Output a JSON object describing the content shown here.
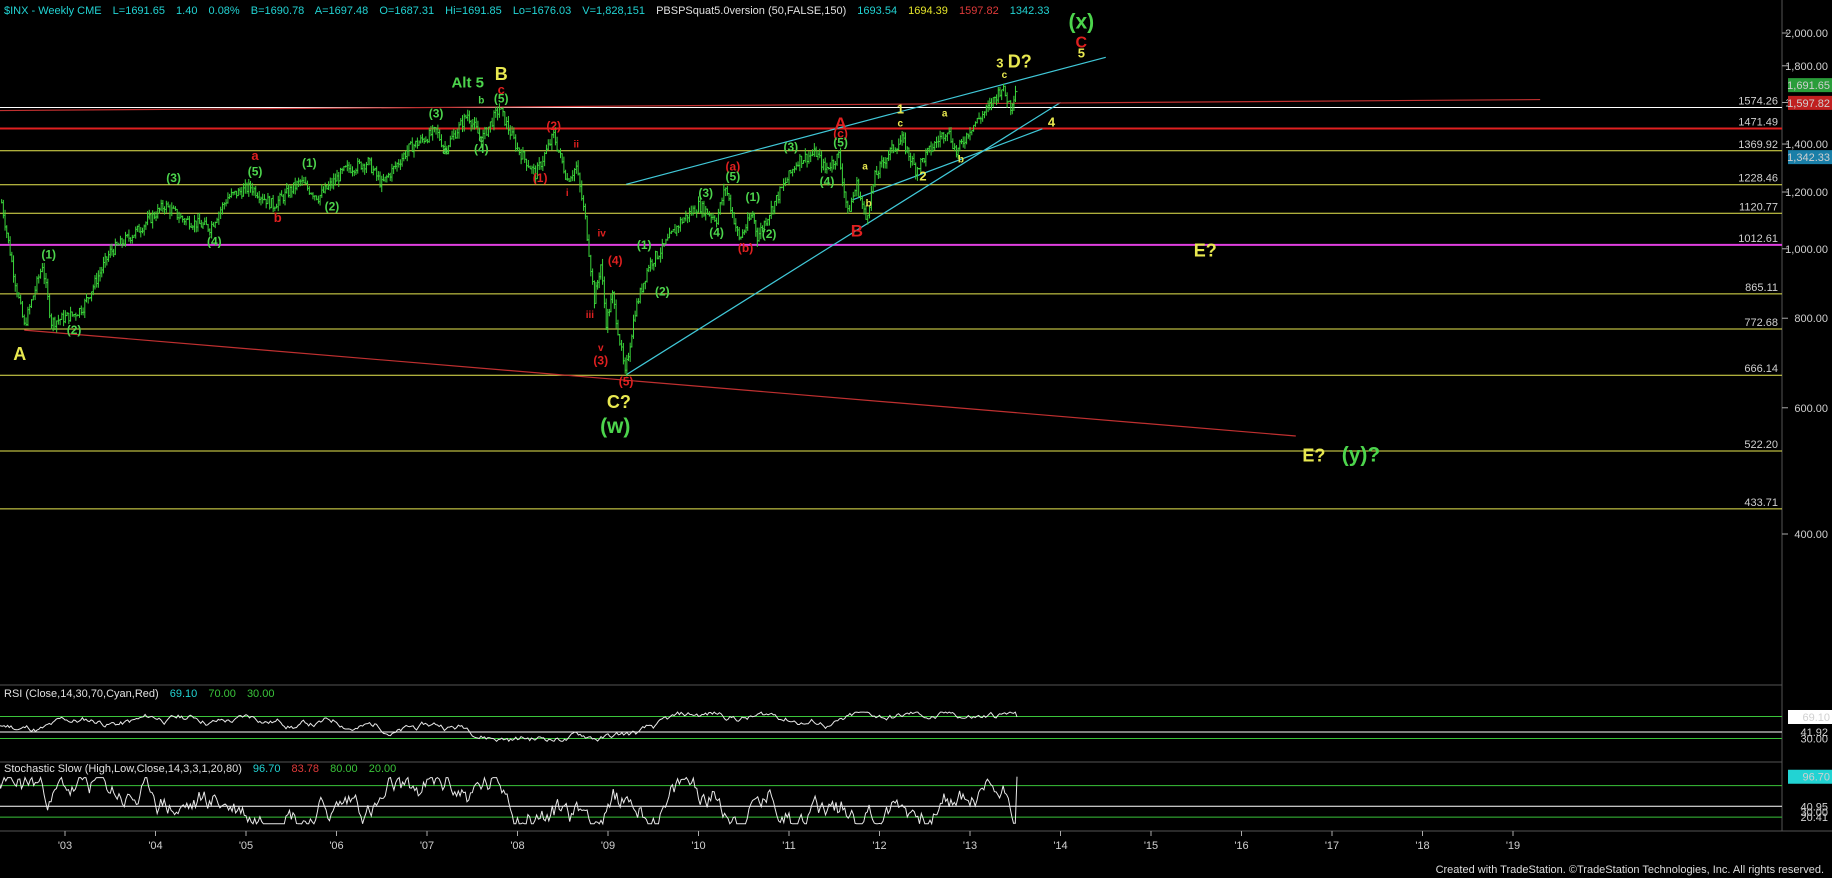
{
  "header": {
    "title": "$INX - Weekly  CME",
    "last": "L=1691.65",
    "change": "1.40",
    "pct": "0.08%",
    "bid": "B=1690.78",
    "ask": "A=1697.48",
    "open": "O=1687.31",
    "high": "Hi=1691.85",
    "low": "Lo=1676.03",
    "volume": "V=1,828,151",
    "indicator": "PBSPSquat5.0version (50,FALSE,150)",
    "ind_values": [
      "1693.54",
      "1694.39",
      "1597.82",
      "1342.33"
    ]
  },
  "chart_data": {
    "type": "ohlc",
    "title": "$INX - Weekly",
    "y_scale": "log",
    "ylim": [
      330,
      2200
    ],
    "y_ticks": [
      "2,000.00",
      "1,800.00",
      "1,600.00",
      "1,400.00",
      "1,200.00",
      "1,000.00",
      "800.00",
      "600.00",
      "400.00"
    ],
    "x_ticks": [
      "'03",
      "'04",
      "'05",
      "'06",
      "'07",
      "'08",
      "'09",
      "'10",
      "'11",
      "'12",
      "'13",
      "'14",
      "'15",
      "'16",
      "'17",
      "'18",
      "'19"
    ],
    "price_path": [
      [
        2002.3,
        1160
      ],
      [
        2002.45,
        900
      ],
      [
        2002.55,
        780
      ],
      [
        2002.75,
        950
      ],
      [
        2002.85,
        790
      ],
      [
        2003.1,
        810
      ],
      [
        2003.2,
        830
      ],
      [
        2003.5,
        990
      ],
      [
        2003.8,
        1060
      ],
      [
        2004.1,
        1150
      ],
      [
        2004.3,
        1100
      ],
      [
        2004.6,
        1070
      ],
      [
        2004.8,
        1180
      ],
      [
        2005.05,
        1220
      ],
      [
        2005.3,
        1150
      ],
      [
        2005.6,
        1240
      ],
      [
        2005.8,
        1180
      ],
      [
        2006.1,
        1290
      ],
      [
        2006.35,
        1320
      ],
      [
        2006.5,
        1230
      ],
      [
        2006.8,
        1380
      ],
      [
        2007.1,
        1460
      ],
      [
        2007.2,
        1380
      ],
      [
        2007.45,
        1540
      ],
      [
        2007.6,
        1420
      ],
      [
        2007.8,
        1570
      ],
      [
        2008.0,
        1380
      ],
      [
        2008.2,
        1270
      ],
      [
        2008.4,
        1440
      ],
      [
        2008.55,
        1250
      ],
      [
        2008.65,
        1300
      ],
      [
        2008.75,
        1100
      ],
      [
        2008.85,
        850
      ],
      [
        2008.92,
        950
      ],
      [
        2008.98,
        790
      ],
      [
        2009.05,
        860
      ],
      [
        2009.19,
        667
      ],
      [
        2009.3,
        820
      ],
      [
        2009.45,
        950
      ],
      [
        2009.6,
        1000
      ],
      [
        2009.8,
        1090
      ],
      [
        2010.0,
        1150
      ],
      [
        2010.2,
        1100
      ],
      [
        2010.3,
        1220
      ],
      [
        2010.45,
        1030
      ],
      [
        2010.6,
        1120
      ],
      [
        2010.65,
        1040
      ],
      [
        2010.9,
        1200
      ],
      [
        2011.1,
        1330
      ],
      [
        2011.3,
        1360
      ],
      [
        2011.4,
        1290
      ],
      [
        2011.55,
        1350
      ],
      [
        2011.65,
        1120
      ],
      [
        2011.75,
        1230
      ],
      [
        2011.85,
        1100
      ],
      [
        2011.95,
        1260
      ],
      [
        2012.1,
        1360
      ],
      [
        2012.25,
        1420
      ],
      [
        2012.4,
        1290
      ],
      [
        2012.55,
        1370
      ],
      [
        2012.75,
        1470
      ],
      [
        2012.85,
        1360
      ],
      [
        2013.0,
        1470
      ],
      [
        2013.2,
        1570
      ],
      [
        2013.35,
        1680
      ],
      [
        2013.45,
        1580
      ],
      [
        2013.52,
        1700
      ]
    ],
    "levels": [
      {
        "value": 1574.26,
        "color": "#ffffff"
      },
      {
        "value": 1471.49,
        "color": "#e02020"
      },
      {
        "value": 1369.92,
        "color": "#e8e850"
      },
      {
        "value": 1228.46,
        "color": "#e8e850"
      },
      {
        "value": 1120.77,
        "color": "#e8e850"
      },
      {
        "value": 1012.61,
        "color": "#e040e0"
      },
      {
        "value": 865.11,
        "color": "#e8e850"
      },
      {
        "value": 772.68,
        "color": "#e8e850"
      },
      {
        "value": 666.14,
        "color": "#e8e850"
      },
      {
        "value": 522.2,
        "color": "#e8e850"
      },
      {
        "value": 433.71,
        "color": "#e8e850"
      }
    ],
    "level_labels": [
      "1574.26",
      "1471.49",
      "1369.92",
      "1228.46",
      "1120.77",
      "1012.61",
      "865.11",
      "772.68",
      "666.14",
      "522.20",
      "433.71"
    ],
    "trendlines": [
      {
        "from": [
          2009.2,
          1230
        ],
        "to": [
          2014.5,
          1850
        ],
        "color": "#40c8d8",
        "log_from": 1230
      },
      {
        "from": [
          2009.2,
          667
        ],
        "to": [
          2014.0,
          1600
        ],
        "color": "#40c8d8"
      },
      {
        "from": [
          2011.7,
          1170
        ],
        "to": [
          2013.8,
          1470
        ],
        "color": "#40c8d8"
      },
      {
        "from": [
          2002.0,
          1558
        ],
        "to": [
          2019.3,
          1615
        ],
        "color": "#c03030"
      },
      {
        "from": [
          2002.55,
          770
        ],
        "to": [
          2016.6,
          548
        ],
        "color": "#c03030"
      }
    ],
    "wave_labels": [
      {
        "text": "A",
        "t": 2002.5,
        "p": 700,
        "color": "#e8e850",
        "size": 18
      },
      {
        "text": "(1)",
        "t": 2002.82,
        "p": 970,
        "color": "#4cd44c",
        "size": 12
      },
      {
        "text": "(2)",
        "t": 2003.1,
        "p": 760,
        "color": "#4cd44c",
        "size": 12
      },
      {
        "text": "(3)",
        "t": 2004.2,
        "p": 1240,
        "color": "#4cd44c",
        "size": 12
      },
      {
        "text": "(4)",
        "t": 2004.65,
        "p": 1010,
        "color": "#4cd44c",
        "size": 12
      },
      {
        "text": "a",
        "t": 2005.1,
        "p": 1330,
        "color": "#e02020",
        "size": 13
      },
      {
        "text": "(5)",
        "t": 2005.1,
        "p": 1265,
        "color": "#4cd44c",
        "size": 12
      },
      {
        "text": "b",
        "t": 2005.35,
        "p": 1090,
        "color": "#e02020",
        "size": 13
      },
      {
        "text": "(1)",
        "t": 2005.7,
        "p": 1300,
        "color": "#4cd44c",
        "size": 12
      },
      {
        "text": "(2)",
        "t": 2005.95,
        "p": 1130,
        "color": "#4cd44c",
        "size": 12
      },
      {
        "text": "(3)",
        "t": 2007.1,
        "p": 1525,
        "color": "#4cd44c",
        "size": 12
      },
      {
        "text": "a",
        "t": 2007.2,
        "p": 1355,
        "color": "#4cd44c",
        "size": 10
      },
      {
        "text": "Alt 5",
        "t": 2007.45,
        "p": 1680,
        "color": "#4cd44c",
        "size": 15
      },
      {
        "text": "b",
        "t": 2007.6,
        "p": 1595,
        "color": "#4cd44c",
        "size": 10
      },
      {
        "text": "c",
        "t": 2007.6,
        "p": 1410,
        "color": "#4cd44c",
        "size": 10
      },
      {
        "text": "(4)",
        "t": 2007.6,
        "p": 1360,
        "color": "#4cd44c",
        "size": 12
      },
      {
        "text": "B",
        "t": 2007.82,
        "p": 1720,
        "color": "#e8e850",
        "size": 18
      },
      {
        "text": "c",
        "t": 2007.82,
        "p": 1645,
        "color": "#e02020",
        "size": 13
      },
      {
        "text": "(5)",
        "t": 2007.82,
        "p": 1600,
        "color": "#4cd44c",
        "size": 12
      },
      {
        "text": "(2)",
        "t": 2008.4,
        "p": 1465,
        "color": "#e02020",
        "size": 12
      },
      {
        "text": "ii",
        "t": 2008.65,
        "p": 1385,
        "color": "#e02020",
        "size": 10
      },
      {
        "text": "(1)",
        "t": 2008.25,
        "p": 1240,
        "color": "#e02020",
        "size": 12
      },
      {
        "text": "i",
        "t": 2008.55,
        "p": 1185,
        "color": "#e02020",
        "size": 10
      },
      {
        "text": "iv",
        "t": 2008.93,
        "p": 1040,
        "color": "#e02020",
        "size": 10
      },
      {
        "text": "(4)",
        "t": 2009.08,
        "p": 950,
        "color": "#e02020",
        "size": 12
      },
      {
        "text": "iii",
        "t": 2008.8,
        "p": 800,
        "color": "#e02020",
        "size": 10
      },
      {
        "text": "v",
        "t": 2008.92,
        "p": 720,
        "color": "#e02020",
        "size": 10
      },
      {
        "text": "(3)",
        "t": 2008.92,
        "p": 690,
        "color": "#e02020",
        "size": 12
      },
      {
        "text": "(5)",
        "t": 2009.2,
        "p": 645,
        "color": "#e02020",
        "size": 12
      },
      {
        "text": "C?",
        "t": 2009.12,
        "p": 600,
        "color": "#e8e850",
        "size": 18
      },
      {
        "text": "(w)",
        "t": 2009.08,
        "p": 553,
        "color": "#4cd44c",
        "size": 21
      },
      {
        "text": "(1)",
        "t": 2009.4,
        "p": 1000,
        "color": "#4cd44c",
        "size": 12
      },
      {
        "text": "(2)",
        "t": 2009.6,
        "p": 860,
        "color": "#4cd44c",
        "size": 12
      },
      {
        "text": "(3)",
        "t": 2010.08,
        "p": 1180,
        "color": "#4cd44c",
        "size": 12
      },
      {
        "text": "(4)",
        "t": 2010.2,
        "p": 1040,
        "color": "#4cd44c",
        "size": 12
      },
      {
        "text": "(a)",
        "t": 2010.38,
        "p": 1285,
        "color": "#e02020",
        "size": 12
      },
      {
        "text": "(5)",
        "t": 2010.38,
        "p": 1245,
        "color": "#4cd44c",
        "size": 12
      },
      {
        "text": "(1)",
        "t": 2010.6,
        "p": 1165,
        "color": "#4cd44c",
        "size": 12
      },
      {
        "text": "(b)",
        "t": 2010.52,
        "p": 990,
        "color": "#e02020",
        "size": 12
      },
      {
        "text": "(2)",
        "t": 2010.78,
        "p": 1035,
        "color": "#4cd44c",
        "size": 12
      },
      {
        "text": "(3)",
        "t": 2011.02,
        "p": 1370,
        "color": "#4cd44c",
        "size": 12
      },
      {
        "text": "(4)",
        "t": 2011.42,
        "p": 1225,
        "color": "#4cd44c",
        "size": 12
      },
      {
        "text": "A",
        "t": 2011.57,
        "p": 1470,
        "color": "#e02020",
        "size": 17
      },
      {
        "text": "(c)",
        "t": 2011.57,
        "p": 1430,
        "color": "#e02020",
        "size": 12
      },
      {
        "text": "(5)",
        "t": 2011.57,
        "p": 1390,
        "color": "#4cd44c",
        "size": 12
      },
      {
        "text": "a",
        "t": 2011.84,
        "p": 1290,
        "color": "#e8e850",
        "size": 10
      },
      {
        "text": "b",
        "t": 2011.88,
        "p": 1145,
        "color": "#e8e850",
        "size": 10
      },
      {
        "text": "B",
        "t": 2011.75,
        "p": 1040,
        "color": "#e02020",
        "size": 17
      },
      {
        "text": "1",
        "t": 2012.23,
        "p": 1545,
        "color": "#e8e850",
        "size": 13
      },
      {
        "text": "c",
        "t": 2012.23,
        "p": 1480,
        "color": "#e8e850",
        "size": 10
      },
      {
        "text": "2",
        "t": 2012.48,
        "p": 1245,
        "color": "#e8e850",
        "size": 13
      },
      {
        "text": "a",
        "t": 2012.72,
        "p": 1530,
        "color": "#e8e850",
        "size": 10
      },
      {
        "text": "b",
        "t": 2012.9,
        "p": 1320,
        "color": "#e8e850",
        "size": 10
      },
      {
        "text": "3",
        "t": 2013.33,
        "p": 1790,
        "color": "#e8e850",
        "size": 13
      },
      {
        "text": "c",
        "t": 2013.38,
        "p": 1730,
        "color": "#e8e850",
        "size": 10
      },
      {
        "text": "D?",
        "t": 2013.55,
        "p": 1790,
        "color": "#e8e850",
        "size": 18
      },
      {
        "text": "4",
        "t": 2013.9,
        "p": 1480,
        "color": "#e8e850",
        "size": 13
      },
      {
        "text": "(x)",
        "t": 2014.23,
        "p": 2030,
        "color": "#4cd44c",
        "size": 21
      },
      {
        "text": "C",
        "t": 2014.23,
        "p": 1910,
        "color": "#e02020",
        "size": 16
      },
      {
        "text": "5",
        "t": 2014.23,
        "p": 1850,
        "color": "#e8e850",
        "size": 13
      },
      {
        "text": "E?",
        "t": 2015.6,
        "p": 975,
        "color": "#e8e850",
        "size": 18
      },
      {
        "text": "E?",
        "t": 2016.8,
        "p": 505,
        "color": "#e8e850",
        "size": 18
      },
      {
        "text": "(y)?",
        "t": 2017.32,
        "p": 505,
        "color": "#4cd44c",
        "size": 21
      }
    ]
  },
  "price_axis_tags": [
    {
      "text": "1,691.65",
      "value": 1691.65,
      "bg": "#2a9d3a",
      "fg": "#ffffff"
    },
    {
      "text": "1,597.82",
      "value": 1597.82,
      "bg": "#c02020",
      "fg": "#ffffff"
    },
    {
      "text": "1,342.33",
      "value": 1342.33,
      "bg": "#1a7fa8",
      "fg": "#ffffff"
    }
  ],
  "rsi": {
    "title": "RSI (Close,14,30,70,Cyan,Red)",
    "value": "69.10",
    "ob": "70.00",
    "os": "30.00",
    "tag_value": "69.10",
    "tags": [
      "41.92",
      "30.00"
    ],
    "current": 69.1
  },
  "stochastic": {
    "title": "Stochastic Slow (High,Low,Close,14,3,3,1,20,80)",
    "k": "96.70",
    "d": "83.78",
    "ob": "80.00",
    "os": "20.00",
    "tag_value": "96.70",
    "tags": [
      "40.95",
      "30.00",
      "20.41"
    ],
    "current": 96.7
  },
  "footer": "Created with TradeStation. ©TradeStation Technologies, Inc. All rights reserved."
}
